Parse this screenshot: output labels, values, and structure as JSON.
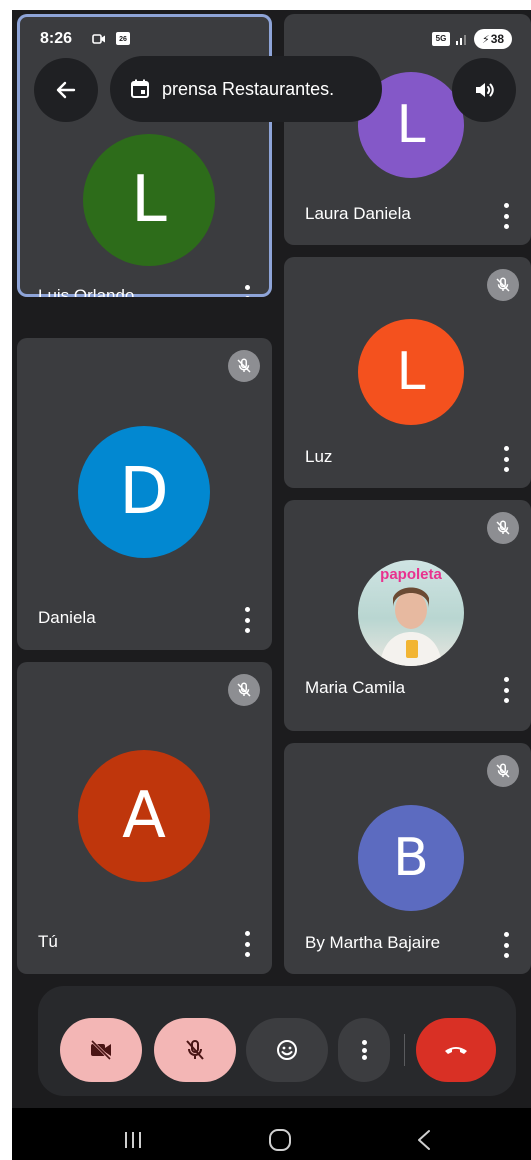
{
  "status": {
    "time": "8:26",
    "calendar_date": "26",
    "network": "5G",
    "battery": "38"
  },
  "header": {
    "meeting_title": "prensa Restaurantes."
  },
  "participants": [
    {
      "name": "Luis Orlando",
      "initial": "L",
      "color": "#2d6c1a"
    },
    {
      "name": "Laura Daniela",
      "initial": "L",
      "color": "#8458c8"
    },
    {
      "name": "Luz",
      "initial": "L",
      "color": "#f4511e"
    },
    {
      "name": "Daniela",
      "initial": "D",
      "color": "#0288d1"
    },
    {
      "name": "Maria Camila",
      "photo_text": "papoleta"
    },
    {
      "name": "Tú",
      "initial": "A",
      "color": "#bf360c"
    },
    {
      "name": "By Martha Bajaire",
      "initial": "B",
      "color": "#5c6bc0"
    }
  ],
  "colors": {
    "background": "#1c1c1e",
    "tile": "#3b3c3f",
    "active_border": "#8ea4d8",
    "control_off": "#f3b6b5",
    "hangup": "#d93025"
  }
}
